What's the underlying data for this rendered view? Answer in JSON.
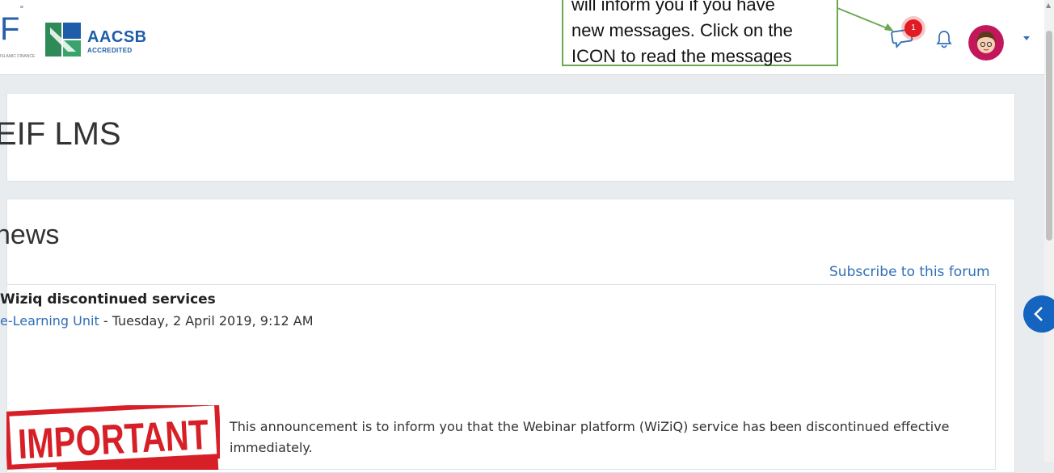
{
  "header": {
    "logo_letter": "F",
    "logo_tagline": "ISLAMIC FINANCE",
    "accreditation_name": "AACSB",
    "accreditation_sub": "ACCREDITED",
    "message_badge_count": "1",
    "colors": {
      "accent": "#2f6fb7",
      "badge": "#e01b22",
      "callout_border": "#6aa84f"
    }
  },
  "callout": {
    "lines": [
      "will inform you if you have",
      "new messages. Click on the",
      "ICON to read the messages"
    ]
  },
  "page": {
    "title": "EIF LMS"
  },
  "news": {
    "heading": "news",
    "subscribe_label": "Subscribe to this forum",
    "post": {
      "subject": "Wiziq discontinued services",
      "author": "e-Learning Unit",
      "date_separator": " - ",
      "date": "Tuesday, 2 April 2019, 9:12 AM",
      "stamp_text": "IMPORTANT",
      "body": "This announcement is to inform you that the Webinar platform (WiZiQ) service has been discontinued effective immediately."
    }
  },
  "icons": {
    "messages": "chat-bubble",
    "notifications": "bell",
    "user_menu": "caret-down",
    "drawer": "chevron-left"
  }
}
